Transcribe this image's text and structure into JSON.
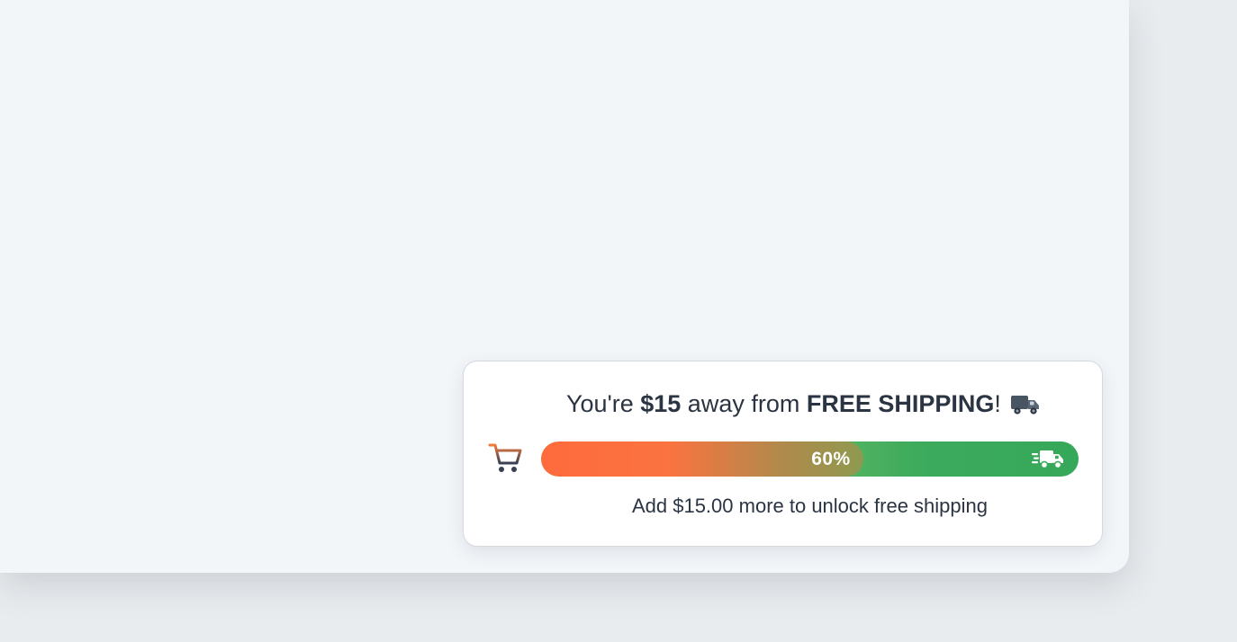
{
  "shipping_widget": {
    "headline_prefix": "You're ",
    "headline_amount": "$15",
    "headline_middle": " away from ",
    "headline_goal": "FREE SHIPPING",
    "headline_suffix": "!",
    "progress_percent": 60,
    "progress_label": "60%",
    "subtext": "Add $15.00 more to unlock free shipping",
    "icons": {
      "left": "shopping-cart-icon",
      "headline": "delivery-truck-icon",
      "bar_end": "fast-delivery-truck-icon"
    },
    "colors": {
      "fill_start": "#ff6b3d",
      "fill_end": "#8e9a50",
      "track_start": "#a8dd8a",
      "track_end": "#36a85a",
      "text": "#2b3442"
    }
  }
}
